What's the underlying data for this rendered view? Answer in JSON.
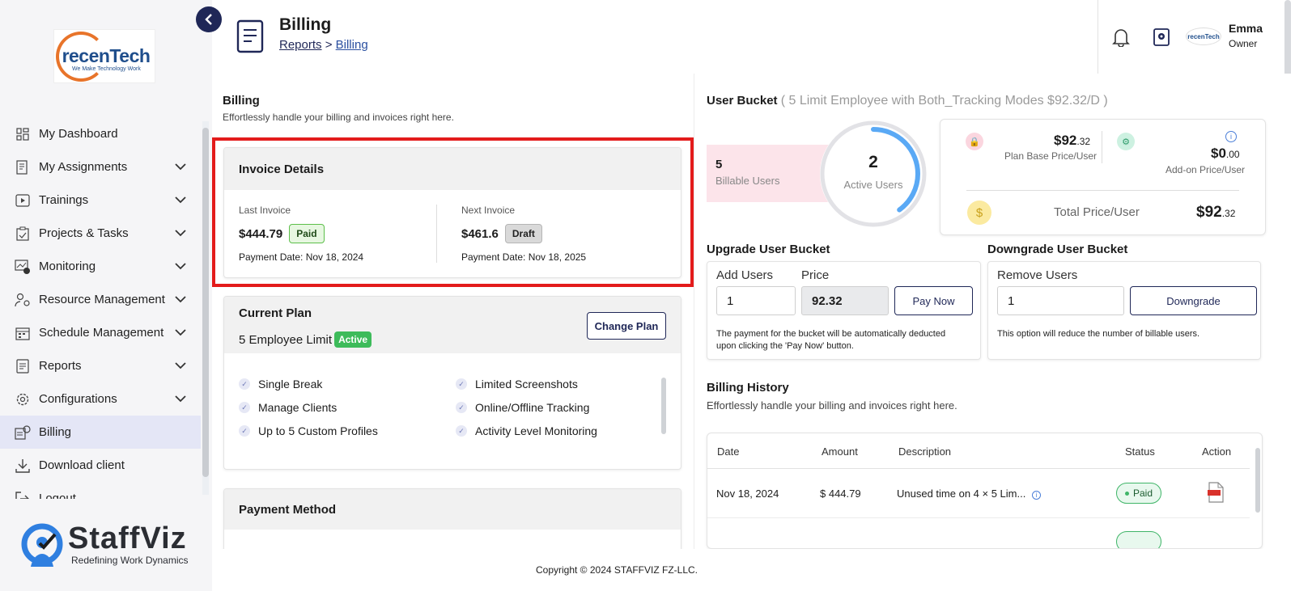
{
  "sidebar": {
    "logo": {
      "name": "recenTech",
      "tagline": "We Make Technology Work"
    },
    "items": [
      {
        "label": "My Dashboard",
        "icon": "dashboard-icon",
        "has_chevron": false,
        "active": false
      },
      {
        "label": "My Assignments",
        "icon": "assignments-icon",
        "has_chevron": true,
        "active": false
      },
      {
        "label": "Trainings",
        "icon": "play-icon",
        "has_chevron": true,
        "active": false
      },
      {
        "label": "Projects & Tasks",
        "icon": "clipboard-icon",
        "has_chevron": true,
        "active": false
      },
      {
        "label": "Monitoring",
        "icon": "monitor-icon",
        "has_chevron": true,
        "active": false
      },
      {
        "label": "Resource Management",
        "icon": "people-gear-icon",
        "has_chevron": true,
        "active": false
      },
      {
        "label": "Schedule Management",
        "icon": "calendar-icon",
        "has_chevron": true,
        "active": false
      },
      {
        "label": "Reports",
        "icon": "report-icon",
        "has_chevron": true,
        "active": false
      },
      {
        "label": "Configurations",
        "icon": "gear-icon",
        "has_chevron": true,
        "active": false
      },
      {
        "label": "Billing",
        "icon": "billing-icon",
        "has_chevron": false,
        "active": true
      },
      {
        "label": "Download client",
        "icon": "download-icon",
        "has_chevron": false,
        "active": false
      },
      {
        "label": "Logout",
        "icon": "logout-icon",
        "has_chevron": false,
        "active": false
      }
    ],
    "brand": {
      "name": "StaffViz",
      "tagline": "Redefining Work Dynamics"
    }
  },
  "header": {
    "title": "Billing",
    "breadcrumb": {
      "parent": "Reports",
      "separator": ">",
      "current": "Billing"
    },
    "avatar_text": "recenTech",
    "user": {
      "name": "Emma",
      "role": "Owner"
    }
  },
  "billing": {
    "title": "Billing",
    "subtitle": "Effortlessly handle your billing and invoices right here."
  },
  "invoice": {
    "title": "Invoice Details",
    "last": {
      "label": "Last Invoice",
      "amount": "$444.79",
      "status": "Paid",
      "date": "Payment Date: Nov 18, 2024"
    },
    "next": {
      "label": "Next Invoice",
      "amount": "$461.6",
      "status": "Draft",
      "date": "Payment Date: Nov 18, 2025"
    }
  },
  "plan": {
    "title": "Current Plan",
    "name": "5 Employee Limit",
    "status": "Active",
    "change_button": "Change Plan",
    "features": [
      "Single Break",
      "Limited Screenshots",
      "Manage Clients",
      "Online/Offline Tracking",
      "Up to 5 Custom Profiles",
      "Activity Level Monitoring"
    ]
  },
  "payment_method": {
    "title": "Payment Method"
  },
  "user_bucket": {
    "title": "User Bucket",
    "detail": "( 5 Limit Employee with Both_Tracking Modes $92.32/D )",
    "billable_count": "5",
    "billable_label": "Billable Users",
    "active_count": "2",
    "active_label": "Active Users",
    "active_fraction": 0.4,
    "plan_base_price": {
      "main": "$92",
      "cents": ".32",
      "label": "Plan Base Price/User"
    },
    "addon_price": {
      "main": "$0",
      "cents": ".00",
      "label": "Add-on Price/User"
    },
    "total_price": {
      "main": "$92",
      "cents": ".32",
      "label": "Total Price/User"
    }
  },
  "upgrade": {
    "title": "Upgrade User Bucket",
    "add_users_label": "Add Users",
    "add_users_value": "1",
    "price_label": "Price",
    "price_value": "92.32",
    "pay_button": "Pay Now",
    "note": "The payment for the bucket will be automatically deducted upon clicking the 'Pay Now' button."
  },
  "downgrade": {
    "title": "Downgrade User Bucket",
    "remove_users_label": "Remove Users",
    "remove_users_value": "1",
    "button": "Downgrade",
    "note": "This option will reduce the number of billable users."
  },
  "history": {
    "title": "Billing History",
    "subtitle": "Effortlessly handle your billing and invoices right here.",
    "columns": [
      "Date",
      "Amount",
      "Description",
      "Status",
      "Action"
    ],
    "rows": [
      {
        "date": "Nov 18, 2024",
        "amount": "$ 444.79",
        "description": "Unused time on 4 × 5 Lim...",
        "status": "Paid"
      }
    ]
  },
  "footer": {
    "copyright": "Copyright © 2024 STAFFVIZ FZ-LLC."
  },
  "colors": {
    "accent": "#1f2757",
    "highlight": "#e31b1b",
    "active_green": "#3dbb5a",
    "gauge": "#5aa9f5"
  }
}
